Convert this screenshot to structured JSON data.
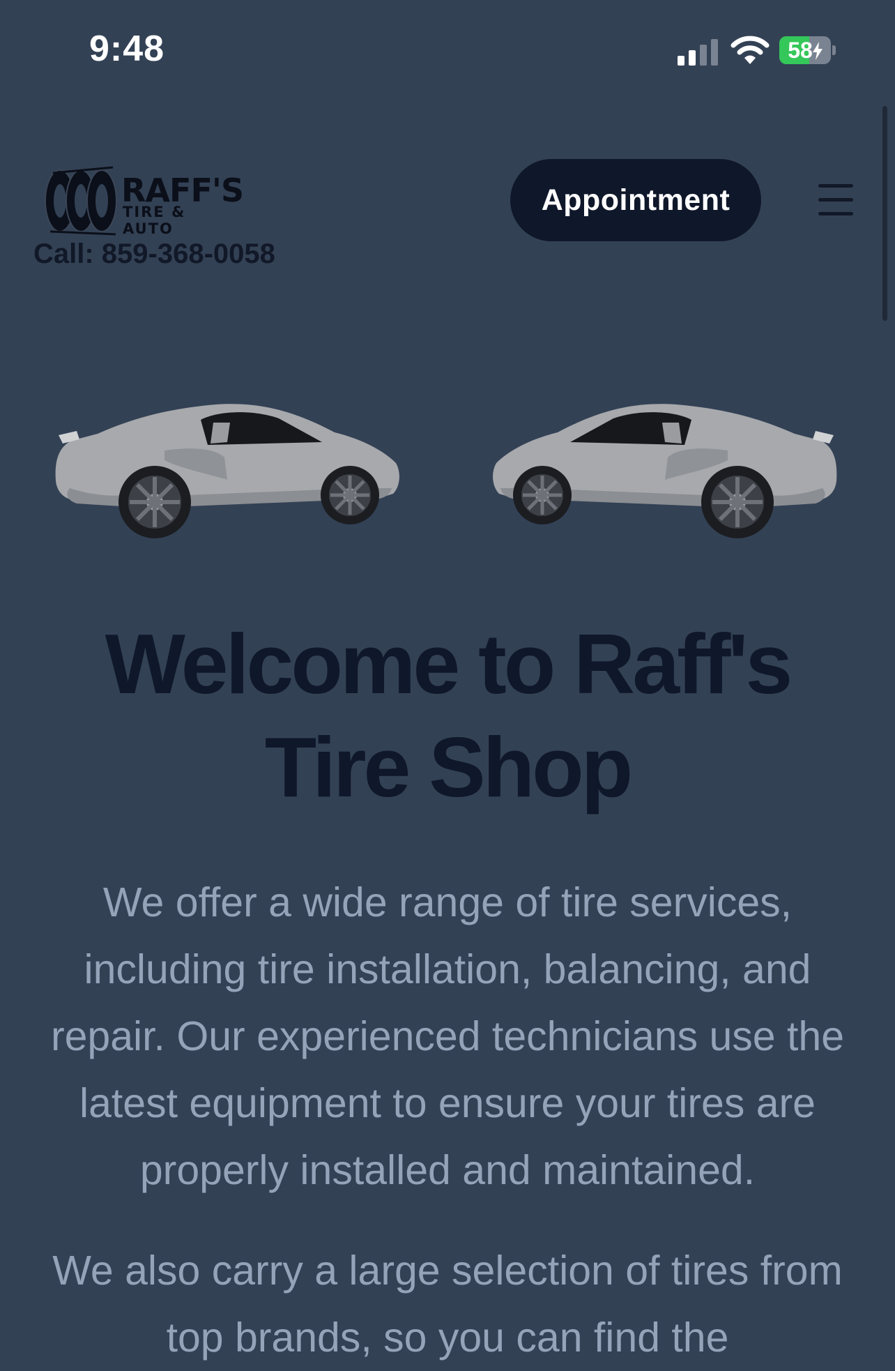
{
  "status_bar": {
    "time": "9:48",
    "battery_level": "58",
    "battery_fraction": 0.58,
    "battery_charging": true,
    "signal_icon": "cellular-signal-icon",
    "wifi_icon": "wifi-icon"
  },
  "header": {
    "logo": {
      "name": "RAFF'S",
      "tagline": "TIRE & AUTO"
    },
    "call_text": "Call: 859-368-0058",
    "appointment_label": "Appointment",
    "menu_icon": "hamburger-menu-icon"
  },
  "hero": {
    "headline": "Welcome to Raff's Tire Shop",
    "paragraph_1": "We offer a wide range of tire services, including tire installation, balancing, and repair. Our experienced technicians use the latest equipment to ensure your tires are properly installed and maintained.",
    "paragraph_2": "We also carry a large selection of tires from top brands, so you can find the"
  },
  "colors": {
    "page_background": "#334155",
    "button_background": "#0f172a",
    "headline": "#0f172a",
    "body_text": "#94a3b8",
    "battery_green": "#34c759"
  }
}
